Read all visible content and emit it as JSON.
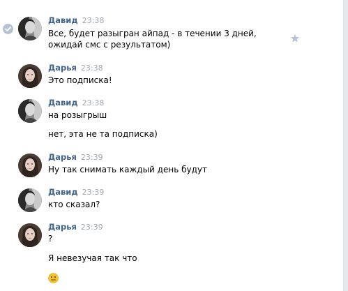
{
  "colors": {
    "author": "#42648b",
    "time": "#a0a8b4",
    "text": "#000000",
    "star": "#b6c3d2",
    "read_mark": "#b6c3d2",
    "emoji": "#f4c430"
  },
  "messages": [
    {
      "author": "Давид",
      "time": "23:38",
      "lines": [
        "Все, будет разыгран айпад - в течении 3 дней, ожидай смс с результатом)"
      ],
      "icons": [
        "read-check-icon",
        "star-icon"
      ]
    },
    {
      "author": "Дарья",
      "time": "23:38",
      "lines": [
        "Это подписка!"
      ]
    },
    {
      "author": "Давид",
      "time": "23:38",
      "lines": [
        "на розыгрыш",
        "нет, эта не та подписка)"
      ]
    },
    {
      "author": "Дарья",
      "time": "23:39",
      "lines": [
        "Ну так снимать каждый день будут"
      ]
    },
    {
      "author": "Давид",
      "time": "23:39",
      "lines": [
        "кто сказал?"
      ]
    },
    {
      "author": "Дарья",
      "time": "23:39",
      "lines": [
        "?",
        "Я невезучая так что"
      ],
      "emoji": "neutral-face-emoji-icon"
    }
  ]
}
